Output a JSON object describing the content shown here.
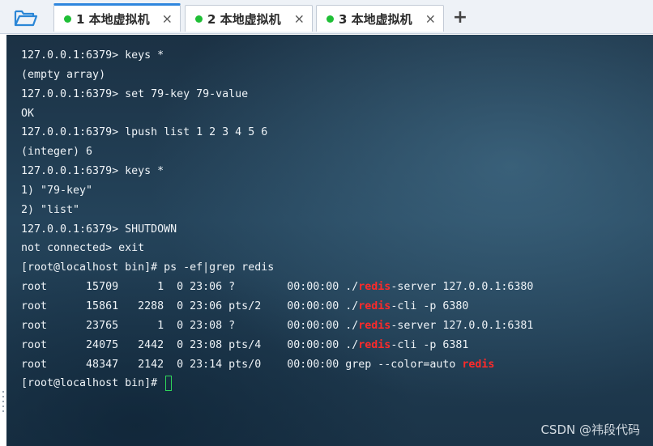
{
  "tabs": [
    {
      "number": "1",
      "title": "本地虚拟机",
      "close": "×"
    },
    {
      "number": "2",
      "title": "本地虚拟机",
      "close": "×"
    },
    {
      "number": "3",
      "title": "本地虚拟机",
      "close": "×"
    }
  ],
  "add_tab_label": "+",
  "terminal": {
    "lines": [
      "127.0.0.1:6379> keys *",
      "(empty array)",
      "127.0.0.1:6379> set 79-key 79-value",
      "OK",
      "127.0.0.1:6379> lpush list 1 2 3 4 5 6",
      "(integer) 6",
      "127.0.0.1:6379> keys *",
      "1) \"79-key\"",
      "2) \"list\"",
      "127.0.0.1:6379> SHUTDOWN",
      "not connected> exit",
      "[root@localhost bin]# ps -ef|grep redis"
    ],
    "ps_rows": [
      {
        "prefix": "root      15709      1  0 23:06 ?        00:00:00 ./",
        "match": "redis",
        "suffix": "-server 127.0.0.1:6380"
      },
      {
        "prefix": "root      15861   2288  0 23:06 pts/2    00:00:00 ./",
        "match": "redis",
        "suffix": "-cli -p 6380"
      },
      {
        "prefix": "root      23765      1  0 23:08 ?        00:00:00 ./",
        "match": "redis",
        "suffix": "-server 127.0.0.1:6381"
      },
      {
        "prefix": "root      24075   2442  0 23:08 pts/4    00:00:00 ./",
        "match": "redis",
        "suffix": "-cli -p 6381"
      },
      {
        "prefix": "root      48347   2142  0 23:14 pts/0    00:00:00 grep --color=auto ",
        "match": "redis",
        "suffix": ""
      }
    ],
    "prompt": "[root@localhost bin]# "
  },
  "watermark": "CSDN @祎段代码",
  "colors": {
    "tab_dot": "#1fbf36",
    "grep_highlight": "#ff2a2a",
    "cursor": "#2fd65a"
  },
  "icons": {
    "open_folder": "folder-open-icon",
    "close_tab": "close-icon",
    "add_tab": "plus-icon"
  }
}
